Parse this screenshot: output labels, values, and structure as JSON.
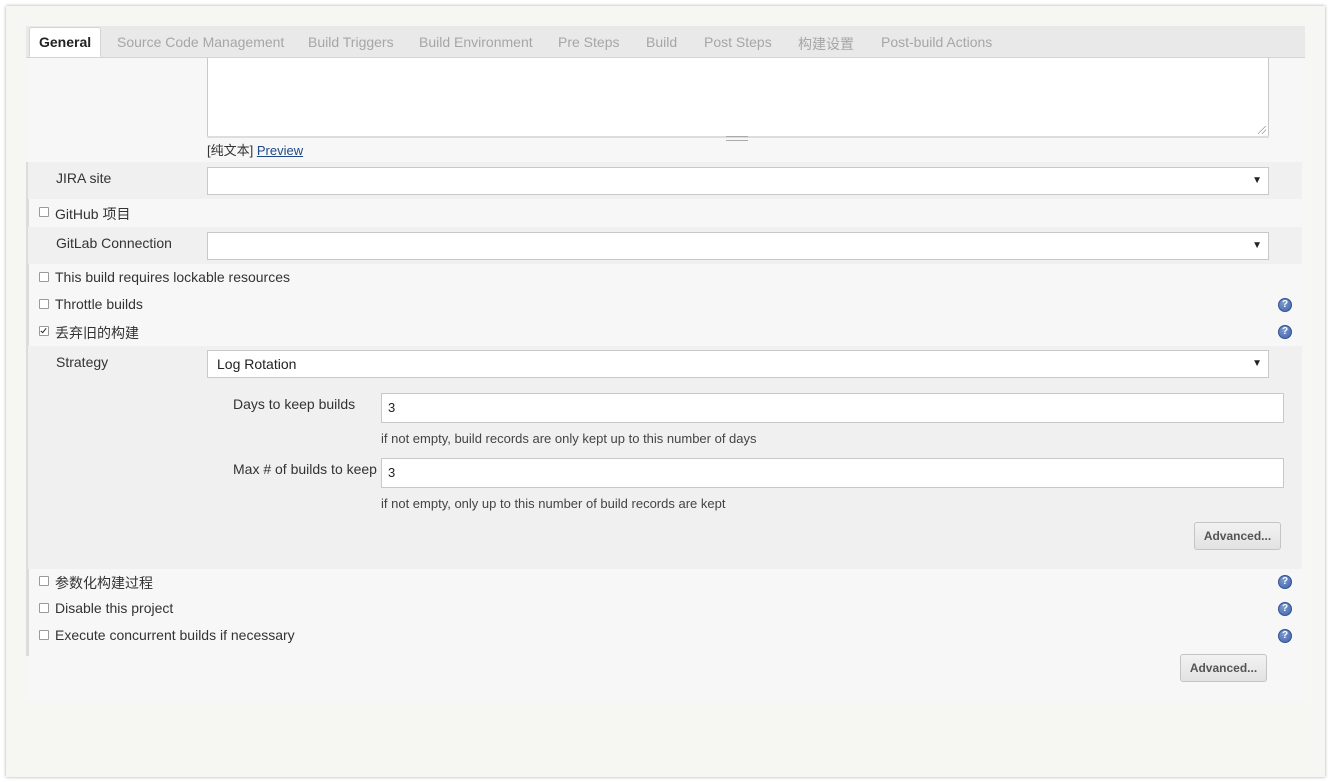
{
  "tabs": [
    {
      "label": "General"
    },
    {
      "label": "Source Code Management"
    },
    {
      "label": "Build Triggers"
    },
    {
      "label": "Build Environment"
    },
    {
      "label": "Pre Steps"
    },
    {
      "label": "Build"
    },
    {
      "label": "Post Steps"
    },
    {
      "label": "构建设置"
    },
    {
      "label": "Post-build Actions"
    }
  ],
  "description": {
    "format_label": "[纯文本]",
    "preview_link": "Preview"
  },
  "jira": {
    "label": "JIRA site",
    "value": ""
  },
  "github_project": {
    "label": "GitHub 项目",
    "checked": false
  },
  "gitlab": {
    "label": "GitLab Connection",
    "value": ""
  },
  "lockable": {
    "label": "This build requires lockable resources",
    "checked": false
  },
  "throttle": {
    "label": "Throttle builds",
    "checked": false
  },
  "discard": {
    "label": "丢弃旧的构建",
    "checked": true,
    "strategy_label": "Strategy",
    "strategy_value": "Log Rotation",
    "days_label": "Days to keep builds",
    "days_value": "3",
    "days_hint": "if not empty, build records are only kept up to this number of days",
    "max_label": "Max # of builds to keep",
    "max_value": "3",
    "max_hint": "if not empty, only up to this number of build records are kept",
    "advanced_label": "Advanced..."
  },
  "parameterized": {
    "label": "参数化构建过程",
    "checked": false
  },
  "disable": {
    "label": "Disable this project",
    "checked": false
  },
  "concurrent": {
    "label": "Execute concurrent builds if necessary",
    "checked": false
  },
  "advanced_bottom_label": "Advanced...",
  "help_glyph": "?",
  "select_arrow_glyph": "▼"
}
